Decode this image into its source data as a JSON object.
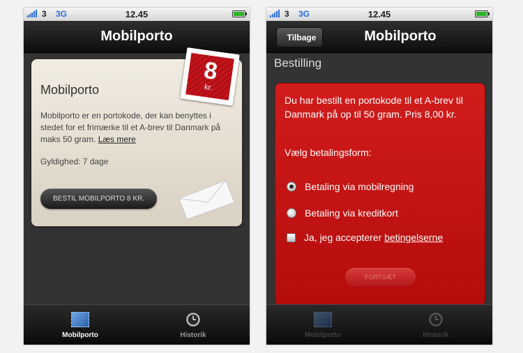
{
  "status": {
    "carrier": "3",
    "network": "3G",
    "time": "12.45"
  },
  "screen1": {
    "nav_title": "Mobilporto",
    "card": {
      "title": "Mobilporto",
      "body": "Mobilporto er en portokode, der kan benyttes i stedet for et frimærke til et A-brev til Danmark på maks 50 gram.",
      "link": "Læs mere",
      "validity": "Gyldighed: 7 dage",
      "buy_button": "BESTIL MOBILPORTO 8 KR.",
      "stamp_value": "8",
      "stamp_unit": "kr."
    }
  },
  "screen2": {
    "back_button": "Tilbage",
    "nav_title": "Mobilporto",
    "section_title": "Bestilling",
    "order_text": "Du har bestilt en portokode til et A-brev til Danmark på op til 50 gram. Pris 8,00 kr.",
    "payment_label": "Vælg betalingsform:",
    "options": [
      {
        "label": "Betaling via mobilregning",
        "selected": true
      },
      {
        "label": "Betaling via kreditkort",
        "selected": false
      }
    ],
    "terms_prefix": "Ja, jeg accepterer ",
    "terms_link": "betingelserne",
    "continue_button": "FORTSÆT"
  },
  "tabs": [
    {
      "label": "Mobilporto",
      "icon": "stamp-icon"
    },
    {
      "label": "Historik",
      "icon": "clock-icon"
    }
  ],
  "colors": {
    "accent_red": "#c4151c",
    "network_blue": "#2a6bd6"
  }
}
